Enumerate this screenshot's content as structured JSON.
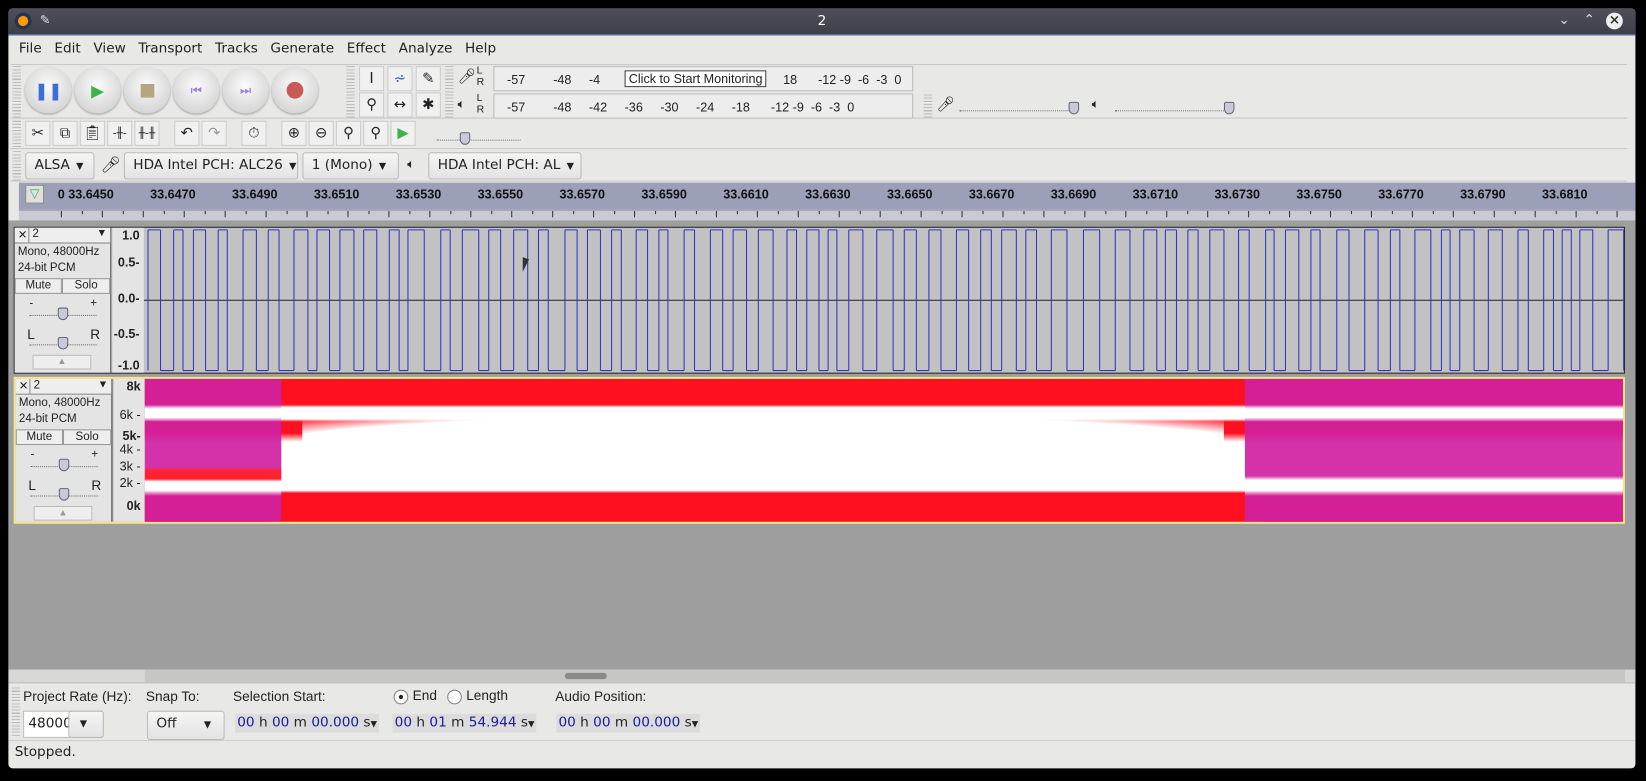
{
  "window": {
    "title": "2"
  },
  "menu": [
    "File",
    "Edit",
    "View",
    "Transport",
    "Tracks",
    "Generate",
    "Effect",
    "Analyze",
    "Help"
  ],
  "meters": {
    "record_scale": "-57        -48     -4",
    "record_scale_tail": "18      -12 -9  -6  -3  0",
    "monitor_tooltip": "Click to Start Monitoring",
    "play_scale": "-57        -48     -42     -36     -30     -24     -18      -12 -9  -6  -3  0",
    "lr": "L\nR"
  },
  "device": {
    "host": "ALSA",
    "recording_device": "HDA Intel PCH: ALC26",
    "channels": "1 (Mono)",
    "playback_device": "HDA Intel PCH: AL"
  },
  "ruler": {
    "ticks": [
      "0",
      "33.6450",
      "33.6470",
      "33.6490",
      "33.6510",
      "33.6530",
      "33.6550",
      "33.6570",
      "33.6590",
      "33.6610",
      "33.6630",
      "33.6650",
      "33.6670",
      "33.6690",
      "33.6710",
      "33.6730",
      "33.6750",
      "33.6770",
      "33.6790",
      "33.6810"
    ]
  },
  "tracks": [
    {
      "name": "2",
      "format": "Mono, 48000Hz",
      "bits": "24-bit PCM",
      "mute": "Mute",
      "solo": "Solo",
      "view": "waveform",
      "scale": [
        "1.0",
        "0.5-",
        "0.0-",
        "-0.5-",
        "-1.0"
      ],
      "gain_minus": "-",
      "gain_plus": "+",
      "pan_l": "L",
      "pan_r": "R",
      "gain": 0.5,
      "pan": 0.5
    },
    {
      "name": "2",
      "format": "Mono, 48000Hz",
      "bits": "24-bit PCM",
      "mute": "Mute",
      "solo": "Solo",
      "view": "spectrogram",
      "scale": [
        "8k",
        "6k -",
        "5k-",
        "4k -",
        "3k -",
        "2k -",
        "0k"
      ],
      "gain_minus": "-",
      "gain_plus": "+",
      "pan_l": "L",
      "pan_r": "R",
      "gain": 0.5,
      "pan": 0.5
    }
  ],
  "selection": {
    "project_rate_label": "Project Rate (Hz):",
    "project_rate": "48000",
    "snap_label": "Snap To:",
    "snap": "Off",
    "start_label": "Selection Start:",
    "end_label": "End",
    "length_label": "Length",
    "end_selected": true,
    "audio_position_label": "Audio Position:",
    "start": {
      "h": "00",
      "m": "00",
      "s": "00.000"
    },
    "end": {
      "h": "00",
      "m": "01",
      "s": "54.944"
    },
    "position": {
      "h": "00",
      "m": "00",
      "s": "00.000"
    },
    "units": {
      "h": "h",
      "m": "m",
      "s": "s"
    }
  },
  "status": "Stopped.",
  "colors": {
    "waveform": "#3232c8",
    "ruler": "#9b9fb8",
    "spectro_low": "#d020a0",
    "spectro_mid": "#ff1020",
    "spectro_high": "#ffffff"
  }
}
